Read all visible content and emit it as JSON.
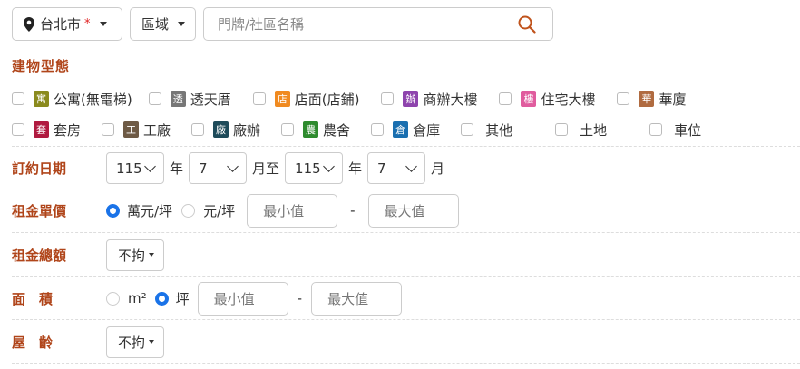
{
  "top": {
    "city": "台北市",
    "required_mark": "*",
    "district": "區域",
    "search_placeholder": "門牌/社區名稱"
  },
  "building_type": {
    "title": "建物型態",
    "row1": [
      {
        "tag": "寓",
        "color": "#8a8a1e",
        "label": "公寓(無電梯)"
      },
      {
        "tag": "透",
        "color": "#777777",
        "label": "透天厝"
      },
      {
        "tag": "店",
        "color": "#f08a20",
        "label": "店面(店鋪)"
      },
      {
        "tag": "辦",
        "color": "#8e44ad",
        "label": "商辦大樓"
      },
      {
        "tag": "樓",
        "color": "#e05c9e",
        "label": "住宅大樓"
      },
      {
        "tag": "華",
        "color": "#b06b40",
        "label": "華廈"
      }
    ],
    "row2": [
      {
        "tag": "套",
        "color": "#b01a40",
        "label": "套房"
      },
      {
        "tag": "工",
        "color": "#6e5a45",
        "label": "工廠"
      },
      {
        "tag": "廠",
        "color": "#1e4b5a",
        "label": "廠辦"
      },
      {
        "tag": "農",
        "color": "#2e8b2e",
        "label": "農舍"
      },
      {
        "tag": "倉",
        "color": "#1a6fb0",
        "label": "倉庫"
      },
      {
        "tag": "",
        "color": "",
        "label": "其他"
      },
      {
        "tag": "",
        "color": "",
        "label": "土地"
      },
      {
        "tag": "",
        "color": "",
        "label": "車位"
      }
    ]
  },
  "contract_date": {
    "label": "訂約日期",
    "from_year": "115",
    "year_text": "年",
    "from_month": "7",
    "month_to_text": "月至",
    "to_year": "115",
    "to_month": "7",
    "month_text": "月"
  },
  "unit_price": {
    "label": "租金單價",
    "opt1": "萬元/坪",
    "opt2": "元/坪",
    "min_placeholder": "最小值",
    "dash": "-",
    "max_placeholder": "最大值"
  },
  "total_rent": {
    "label": "租金總額",
    "value": "不拘"
  },
  "area": {
    "label": "面　積",
    "opt1": "m²",
    "opt2": "坪",
    "min_placeholder": "最小值",
    "dash": "-",
    "max_placeholder": "最大值"
  },
  "age": {
    "label": "屋　齡",
    "value": "不拘"
  }
}
